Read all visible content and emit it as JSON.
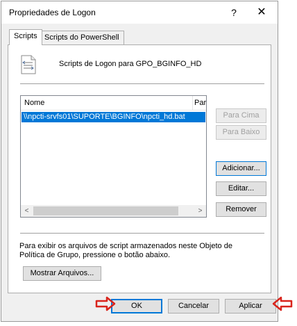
{
  "dialog": {
    "title": "Propriedades de Logon",
    "help_glyph": "?",
    "close_glyph": "✕"
  },
  "tabs": [
    {
      "label": "Scripts",
      "active": true
    },
    {
      "label": "Scripts do PowerShell",
      "active": false
    }
  ],
  "panel": {
    "heading": "Scripts de Logon para GPO_BGINFO_HD",
    "icon": "script-file-icon",
    "list": {
      "columns": [
        "Nome",
        "Parâmetros"
      ],
      "rows": [
        {
          "name": "\\\\npcti-srvfs01\\SUPORTE\\BGINFO\\npcti_hd.bat",
          "selected": true
        }
      ],
      "scroll_left_glyph": "<",
      "scroll_right_glyph": ">"
    },
    "buttons": {
      "up": "Para Cima",
      "down": "Para Baixo",
      "add": "Adicionar...",
      "edit": "Editar...",
      "remove": "Remover"
    },
    "info_text": "Para exibir os arquivos de script armazenados neste Objeto de Política de Grupo, pressione o botão abaixo.",
    "show_files": "Mostrar Arquivos..."
  },
  "footer": {
    "ok": "OK",
    "cancel": "Cancelar",
    "apply": "Aplicar"
  },
  "annotation_color": "#d9241c",
  "accent_color": "#0078d7"
}
